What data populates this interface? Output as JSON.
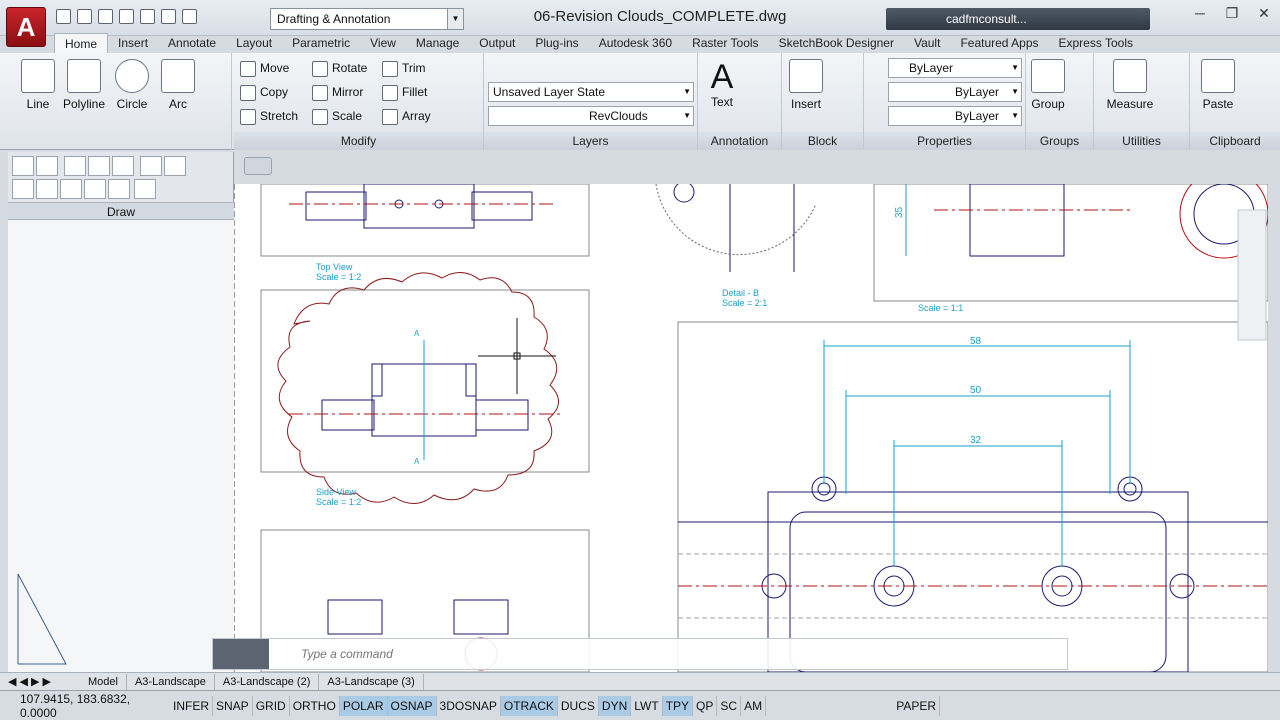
{
  "app": {
    "logo": "A",
    "workspace": "Drafting & Annotation",
    "window_title": "06-Revision Clouds_COMPLETE.dwg",
    "user": "cadfmconsult..."
  },
  "tabs": [
    "Home",
    "Insert",
    "Annotate",
    "Layout",
    "Parametric",
    "View",
    "Manage",
    "Output",
    "Plug-ins",
    "Autodesk 360",
    "Raster Tools",
    "SketchBook Designer",
    "Vault",
    "Featured Apps",
    "Express Tools"
  ],
  "ribbon": {
    "draw": {
      "line": "Line",
      "polyline": "Polyline",
      "circle": "Circle",
      "arc": "Arc"
    },
    "modify": {
      "title": "Modify",
      "move": "Move",
      "rotate": "Rotate",
      "trim": "Trim",
      "copy": "Copy",
      "mirror": "Mirror",
      "fillet": "Fillet",
      "stretch": "Stretch",
      "scale": "Scale",
      "array": "Array"
    },
    "layers": {
      "title": "Layers",
      "state": "Unsaved Layer State",
      "layer": "RevClouds"
    },
    "annotation": {
      "title": "Annotation",
      "text": "Text"
    },
    "block": {
      "title": "Block",
      "insert": "Insert"
    },
    "properties": {
      "title": "Properties",
      "color": "ByLayer",
      "linetype": "ByLayer",
      "lineweight": "ByLayer"
    },
    "groups": {
      "title": "Groups",
      "group": "Group"
    },
    "utilities": {
      "title": "Utilities",
      "measure": "Measure"
    },
    "clipboard": {
      "title": "Clipboard",
      "paste": "Paste"
    }
  },
  "palette": {
    "title": "Draw"
  },
  "drawing": {
    "labels": {
      "top_view": "Top View",
      "top_scale": "Scale = 1:2",
      "side_view": "Side View",
      "side_scale": "Scale = 1:2",
      "detail_b": "Detail - B",
      "detail_scale": "Scale = 2:1",
      "scale_11": "Scale = 1:1",
      "a_top": "A",
      "a_bottom": "A"
    },
    "dims": {
      "d58": "58",
      "d50": "50",
      "d32": "32",
      "d35": "35"
    }
  },
  "command": {
    "placeholder": "Type a command"
  },
  "layout_tabs": [
    "Model",
    "A3-Landscape",
    "A3-Landscape (2)",
    "A3-Landscape (3)"
  ],
  "status": {
    "coords": "107.9415, 183.6832, 0.0000",
    "toggles": [
      "INFER",
      "SNAP",
      "GRID",
      "ORTHO",
      "POLAR",
      "OSNAP",
      "3DOSNAP",
      "OTRACK",
      "DUCS",
      "DYN",
      "LWT",
      "TPY",
      "QP",
      "SC",
      "AM"
    ],
    "on": [
      "POLAR",
      "OSNAP",
      "OTRACK",
      "DYN",
      "TPY"
    ],
    "paper": "PAPER"
  },
  "colors": {
    "revcloud": "#8b1a1a",
    "dim": "#1aa0c8",
    "geometry": "#1a1a6e",
    "center": "#b01010"
  }
}
